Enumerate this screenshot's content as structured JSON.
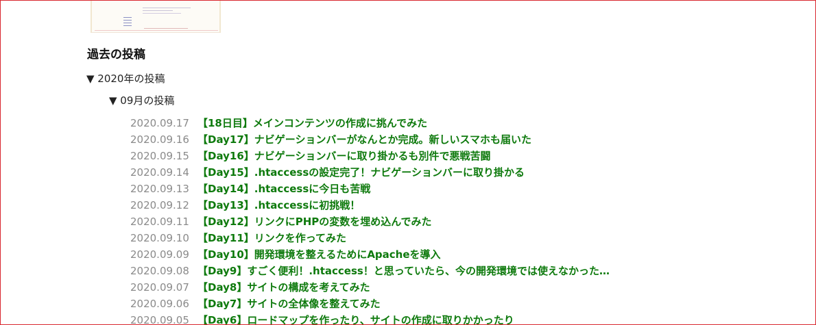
{
  "archive": {
    "heading": "過去の投稿",
    "year_toggle": "▼ 2020年の投稿",
    "month_toggle": "▼ 09月の投稿",
    "posts": [
      {
        "date": "2020.09.17",
        "title": "【18日目】メインコンテンツの作成に挑んでみた"
      },
      {
        "date": "2020.09.16",
        "title": "【Day17】ナビゲーションバーがなんとか完成。新しいスマホも届いた"
      },
      {
        "date": "2020.09.15",
        "title": "【Day16】ナビゲーションバーに取り掛かるも別件で悪戦苦闘"
      },
      {
        "date": "2020.09.14",
        "title": "【Day15】.htaccessの設定完了！ナビゲーションバーに取り掛かる"
      },
      {
        "date": "2020.09.13",
        "title": "【Day14】.htaccessに今日も苦戦"
      },
      {
        "date": "2020.09.12",
        "title": "【Day13】.htaccessに初挑戦！"
      },
      {
        "date": "2020.09.11",
        "title": "【Day12】リンクにPHPの変数を埋め込んでみた"
      },
      {
        "date": "2020.09.10",
        "title": "【Day11】リンクを作ってみた"
      },
      {
        "date": "2020.09.09",
        "title": "【Day10】開発環境を整えるためにApacheを導入"
      },
      {
        "date": "2020.09.08",
        "title": "【Day9】すごく便利！.htaccess！と思っていたら、今の開発環境では使えなかった…"
      },
      {
        "date": "2020.09.07",
        "title": "【Day8】サイトの構成を考えてみた"
      },
      {
        "date": "2020.09.06",
        "title": "【Day7】サイトの全体像を整えてみた"
      },
      {
        "date": "2020.09.05",
        "title": "【Day6】ロードマップを作ったり、サイトの作成に取りかかったり"
      }
    ]
  },
  "colors": {
    "border": "#d9262e",
    "link": "#0e7a0d",
    "date": "#8a8a8a"
  }
}
